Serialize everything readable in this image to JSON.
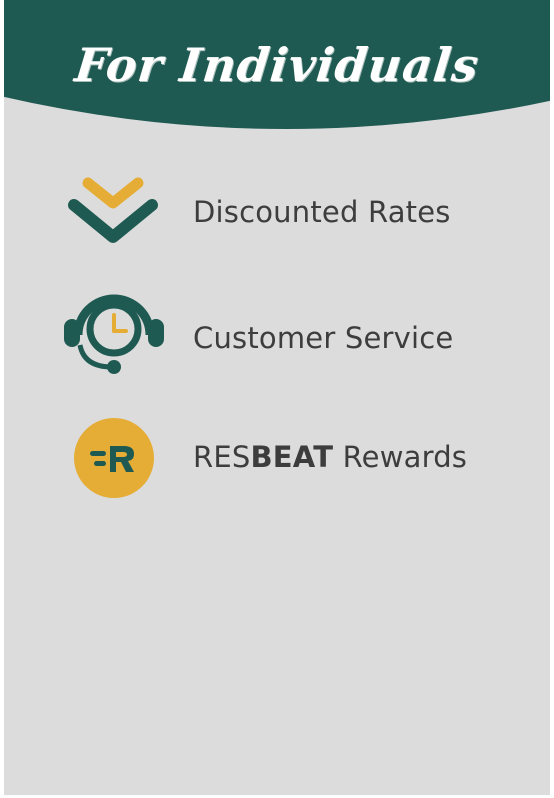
{
  "header": {
    "title": "For Individuals"
  },
  "features": [
    {
      "label": "Discounted Rates",
      "icon": "double-chevron-down-icon"
    },
    {
      "label": "Customer Service",
      "icon": "headset-clock-icon"
    },
    {
      "label_prefix": "RES",
      "label_bold": "BEAT",
      "label_suffix": " Rewards",
      "icon": "resbeat-logo-icon"
    }
  ],
  "colors": {
    "header_green": "#1f5a52",
    "accent_gold": "#e5ad35",
    "background": "#dcdcdc",
    "text": "#3d3d3d"
  }
}
